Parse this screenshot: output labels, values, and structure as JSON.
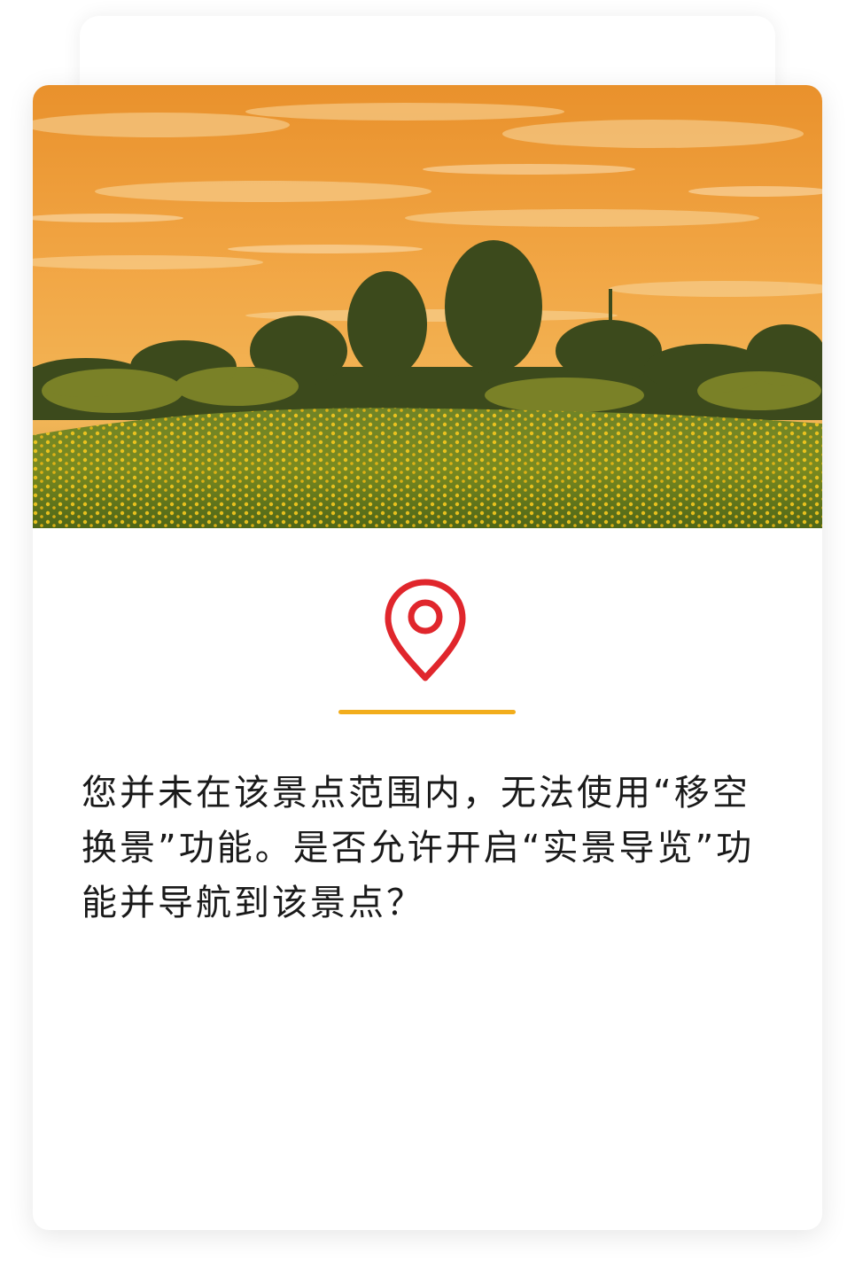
{
  "dialog": {
    "image_alt": "sunset-meadow-with-yellow-flowers",
    "icon": "location-pin-icon",
    "message": "您并未在该景点范围内，无法使用“移空换景”功能。是否允许开启“实景导览”功能并导航到该景点？"
  },
  "colors": {
    "pin_red": "#e0262c",
    "divider_orange": "#f2ad1c",
    "text": "#1a1a1a",
    "sky_orange": "#f0a03a",
    "field_green": "#5e7a1e",
    "flower_yellow": "#f2c21a"
  }
}
